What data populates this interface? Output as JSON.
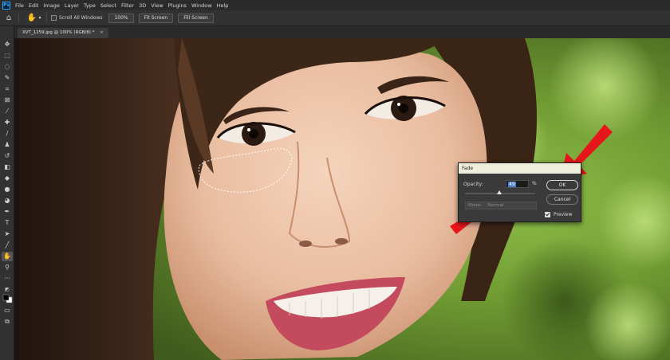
{
  "app": {
    "logo": "Ps",
    "menu": [
      "File",
      "Edit",
      "Image",
      "Layer",
      "Type",
      "Select",
      "Filter",
      "3D",
      "View",
      "Plugins",
      "Window",
      "Help"
    ]
  },
  "options_bar": {
    "hand_icon": "hand-icon",
    "scroll_all_windows": "Scroll All Windows",
    "buttons": [
      "100%",
      "Fit Screen",
      "Fill Screen"
    ]
  },
  "document": {
    "tab_title": "XVT_1259.jpg @ 100% (RGB/8) *"
  },
  "toolbar": {
    "tools": [
      "move-tool-icon",
      "marquee-tool-icon",
      "lasso-tool-icon",
      "quick-selection-icon",
      "crop-tool-icon",
      "frame-tool-icon",
      "eyedropper-icon",
      "healing-brush-icon",
      "brush-tool-icon",
      "clone-stamp-icon",
      "history-brush-icon",
      "eraser-icon",
      "paint-bucket-icon",
      "blur-tool-icon",
      "dodge-tool-icon",
      "pen-tool-icon",
      "type-tool-icon",
      "path-selection-icon",
      "line-tool-icon",
      "hand-tool-icon",
      "zoom-tool-icon",
      "more-tools-icon",
      "default-colors-icon",
      "color-swatches-icon",
      "quick-mask-icon",
      "screen-mode-icon"
    ]
  },
  "fade_dialog": {
    "title": "Fade",
    "opacity_label": "Opacity:",
    "opacity_value": "49",
    "opacity_percent": 49,
    "percent_sign": "%",
    "mode_label": "Mode:",
    "mode_value": "Normal",
    "ok_label": "OK",
    "cancel_label": "Cancel",
    "preview_label": "Preview",
    "preview_checked": true
  },
  "colors": {
    "annotation_arrow": "#e8151b",
    "ok_selected_input": "#4a7fd4"
  }
}
